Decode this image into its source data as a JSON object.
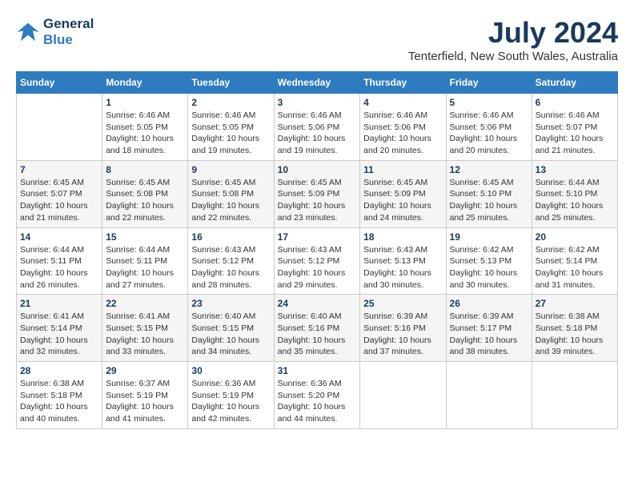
{
  "logo": {
    "line1": "General",
    "line2": "Blue"
  },
  "title": "July 2024",
  "location": "Tenterfield, New South Wales, Australia",
  "days_header": [
    "Sunday",
    "Monday",
    "Tuesday",
    "Wednesday",
    "Thursday",
    "Friday",
    "Saturday"
  ],
  "weeks": [
    [
      {
        "day": "",
        "info": ""
      },
      {
        "day": "1",
        "info": "Sunrise: 6:46 AM\nSunset: 5:05 PM\nDaylight: 10 hours\nand 18 minutes."
      },
      {
        "day": "2",
        "info": "Sunrise: 6:46 AM\nSunset: 5:05 PM\nDaylight: 10 hours\nand 19 minutes."
      },
      {
        "day": "3",
        "info": "Sunrise: 6:46 AM\nSunset: 5:06 PM\nDaylight: 10 hours\nand 19 minutes."
      },
      {
        "day": "4",
        "info": "Sunrise: 6:46 AM\nSunset: 5:06 PM\nDaylight: 10 hours\nand 20 minutes."
      },
      {
        "day": "5",
        "info": "Sunrise: 6:46 AM\nSunset: 5:06 PM\nDaylight: 10 hours\nand 20 minutes."
      },
      {
        "day": "6",
        "info": "Sunrise: 6:46 AM\nSunset: 5:07 PM\nDaylight: 10 hours\nand 21 minutes."
      }
    ],
    [
      {
        "day": "7",
        "info": "Sunrise: 6:45 AM\nSunset: 5:07 PM\nDaylight: 10 hours\nand 21 minutes."
      },
      {
        "day": "8",
        "info": "Sunrise: 6:45 AM\nSunset: 5:08 PM\nDaylight: 10 hours\nand 22 minutes."
      },
      {
        "day": "9",
        "info": "Sunrise: 6:45 AM\nSunset: 5:08 PM\nDaylight: 10 hours\nand 22 minutes."
      },
      {
        "day": "10",
        "info": "Sunrise: 6:45 AM\nSunset: 5:09 PM\nDaylight: 10 hours\nand 23 minutes."
      },
      {
        "day": "11",
        "info": "Sunrise: 6:45 AM\nSunset: 5:09 PM\nDaylight: 10 hours\nand 24 minutes."
      },
      {
        "day": "12",
        "info": "Sunrise: 6:45 AM\nSunset: 5:10 PM\nDaylight: 10 hours\nand 25 minutes."
      },
      {
        "day": "13",
        "info": "Sunrise: 6:44 AM\nSunset: 5:10 PM\nDaylight: 10 hours\nand 25 minutes."
      }
    ],
    [
      {
        "day": "14",
        "info": "Sunrise: 6:44 AM\nSunset: 5:11 PM\nDaylight: 10 hours\nand 26 minutes."
      },
      {
        "day": "15",
        "info": "Sunrise: 6:44 AM\nSunset: 5:11 PM\nDaylight: 10 hours\nand 27 minutes."
      },
      {
        "day": "16",
        "info": "Sunrise: 6:43 AM\nSunset: 5:12 PM\nDaylight: 10 hours\nand 28 minutes."
      },
      {
        "day": "17",
        "info": "Sunrise: 6:43 AM\nSunset: 5:12 PM\nDaylight: 10 hours\nand 29 minutes."
      },
      {
        "day": "18",
        "info": "Sunrise: 6:43 AM\nSunset: 5:13 PM\nDaylight: 10 hours\nand 30 minutes."
      },
      {
        "day": "19",
        "info": "Sunrise: 6:42 AM\nSunset: 5:13 PM\nDaylight: 10 hours\nand 30 minutes."
      },
      {
        "day": "20",
        "info": "Sunrise: 6:42 AM\nSunset: 5:14 PM\nDaylight: 10 hours\nand 31 minutes."
      }
    ],
    [
      {
        "day": "21",
        "info": "Sunrise: 6:41 AM\nSunset: 5:14 PM\nDaylight: 10 hours\nand 32 minutes."
      },
      {
        "day": "22",
        "info": "Sunrise: 6:41 AM\nSunset: 5:15 PM\nDaylight: 10 hours\nand 33 minutes."
      },
      {
        "day": "23",
        "info": "Sunrise: 6:40 AM\nSunset: 5:15 PM\nDaylight: 10 hours\nand 34 minutes."
      },
      {
        "day": "24",
        "info": "Sunrise: 6:40 AM\nSunset: 5:16 PM\nDaylight: 10 hours\nand 35 minutes."
      },
      {
        "day": "25",
        "info": "Sunrise: 6:39 AM\nSunset: 5:16 PM\nDaylight: 10 hours\nand 37 minutes."
      },
      {
        "day": "26",
        "info": "Sunrise: 6:39 AM\nSunset: 5:17 PM\nDaylight: 10 hours\nand 38 minutes."
      },
      {
        "day": "27",
        "info": "Sunrise: 6:38 AM\nSunset: 5:18 PM\nDaylight: 10 hours\nand 39 minutes."
      }
    ],
    [
      {
        "day": "28",
        "info": "Sunrise: 6:38 AM\nSunset: 5:18 PM\nDaylight: 10 hours\nand 40 minutes."
      },
      {
        "day": "29",
        "info": "Sunrise: 6:37 AM\nSunset: 5:19 PM\nDaylight: 10 hours\nand 41 minutes."
      },
      {
        "day": "30",
        "info": "Sunrise: 6:36 AM\nSunset: 5:19 PM\nDaylight: 10 hours\nand 42 minutes."
      },
      {
        "day": "31",
        "info": "Sunrise: 6:36 AM\nSunset: 5:20 PM\nDaylight: 10 hours\nand 44 minutes."
      },
      {
        "day": "",
        "info": ""
      },
      {
        "day": "",
        "info": ""
      },
      {
        "day": "",
        "info": ""
      }
    ]
  ]
}
